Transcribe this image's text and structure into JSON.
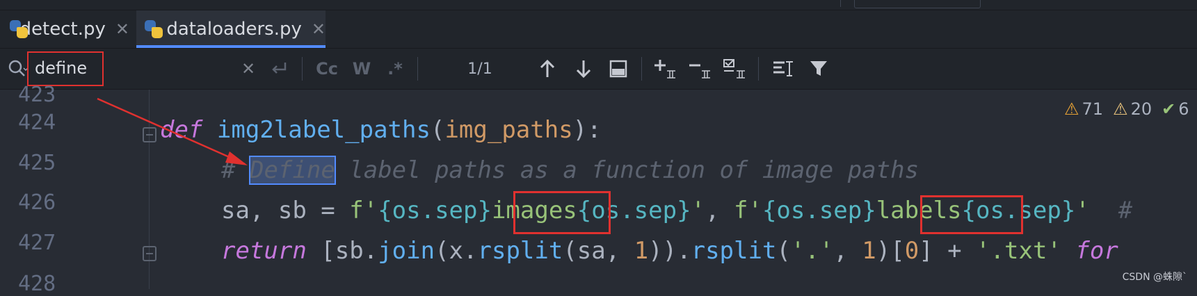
{
  "tabs": [
    {
      "label": "detect.py",
      "close": "✕",
      "active": false
    },
    {
      "label": "dataloaders.py",
      "close": "✕",
      "active": true
    }
  ],
  "find": {
    "query": "define",
    "clear": "✕",
    "options": {
      "case": "Cc",
      "word": "W",
      "regex": ".*"
    },
    "counter": "1/1"
  },
  "gutter": {
    "lines": [
      "423",
      "424",
      "425",
      "426",
      "427",
      "428"
    ]
  },
  "inspections": {
    "errors": "71",
    "warnings": "20",
    "ok": "6"
  },
  "code": {
    "l424": {
      "kw": "def",
      "fn": "img2label_paths",
      "open": "(",
      "param": "img_paths",
      "close": "):"
    },
    "l425": {
      "hash": "#",
      "match": "Define",
      "rest": " label paths as a function of image paths"
    },
    "l426": {
      "p1": "sa, sb = ",
      "f1": "f'",
      "b1": "{os.sep}",
      "images": "images",
      "b2": "{os.sep}",
      "q1": "'",
      "comma": ", ",
      "f2": "f'",
      "b3": "{os.sep}",
      "labels": "labels",
      "b4": "{os.sep}",
      "q2": "'",
      "tail": "  #"
    },
    "l427": {
      "kw": "return",
      "p1": " [sb.",
      "m1": "join",
      "p2": "(x.",
      "m2": "rsplit",
      "p3": "(sa, ",
      "n1": "1",
      "p4": ")).",
      "m3": "rsplit",
      "p5": "(",
      "s1": "'.'",
      "p6": ", ",
      "n2": "1",
      "p7": ")[",
      "n3": "0",
      "p8": "] + ",
      "s2": "'.txt'",
      "p9": " ",
      "kw2": "for"
    }
  },
  "colors": {
    "accent": "#528bff",
    "annotation_red": "#e0312f"
  },
  "watermark": "CSDN @蛛隙`"
}
